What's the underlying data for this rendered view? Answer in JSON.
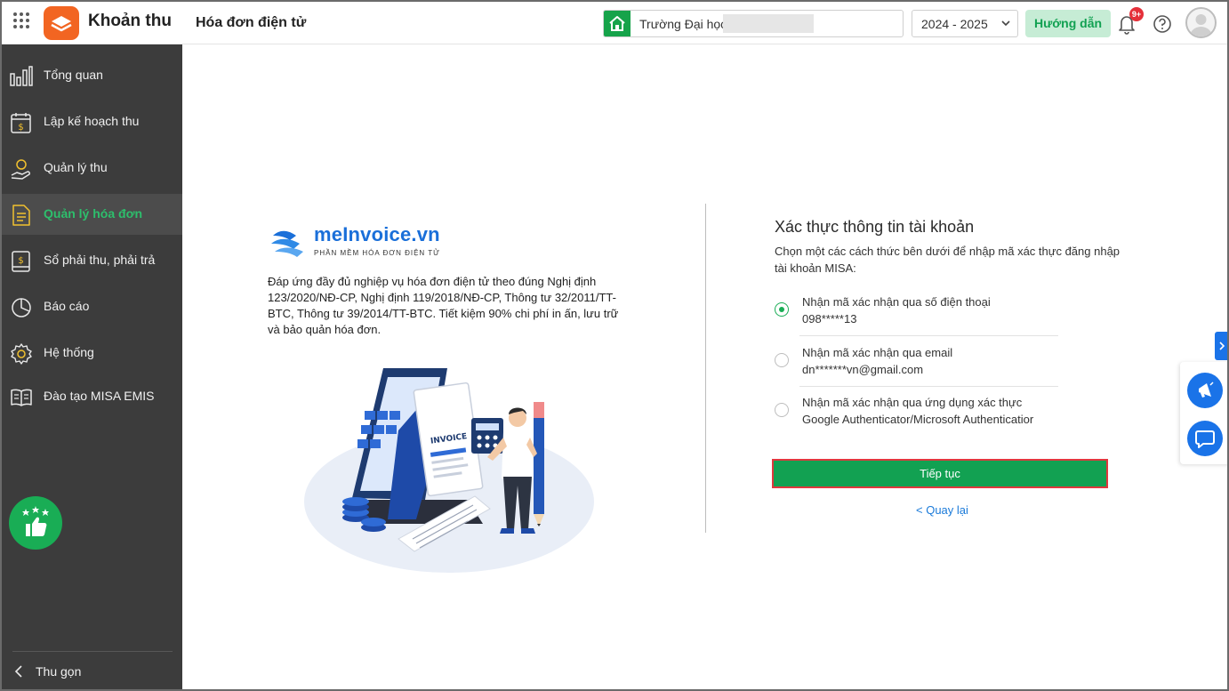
{
  "header": {
    "app_title": "Khoản thu",
    "page_title": "Hóa đơn điện tử",
    "school_label": "Trường Đại học",
    "school_year": "2024 - 2025",
    "help_label": "Hướng dẫn",
    "notification_badge": "9+"
  },
  "sidebar": {
    "items": [
      {
        "label": "Tổng quan",
        "icon": "bar-chart-icon"
      },
      {
        "label": "Lập kế hoạch thu",
        "icon": "calendar-dollar-icon"
      },
      {
        "label": "Quản lý thu",
        "icon": "hand-coin-icon"
      },
      {
        "label": "Quản lý hóa đơn",
        "icon": "document-icon",
        "active": true
      },
      {
        "label": "Sổ phải thu, phải trả",
        "icon": "ledger-icon"
      },
      {
        "label": "Báo cáo",
        "icon": "pie-chart-icon"
      },
      {
        "label": "Hệ thống",
        "icon": "gear-icon"
      },
      {
        "label": "Đào tạo MISA EMIS",
        "icon": "open-book-icon"
      }
    ],
    "collapse_label": "Thu gọn"
  },
  "promo": {
    "brand_name": "meInvoice.vn",
    "brand_tagline": "PHẦN MỀM HÓA ĐƠN ĐIỆN TỬ",
    "description": "Đáp ứng đầy đủ nghiệp vụ hóa đơn điện tử theo đúng Nghị định 123/2020/NĐ-CP, Nghị định 119/2018/NĐ-CP, Thông tư 32/2011/TT-BTC, Thông tư 39/2014/TT-BTC. Tiết kiệm 90% chi phí in ấn, lưu trữ và bảo quản hóa đơn.",
    "illustration_text": "INVOICE"
  },
  "auth": {
    "title": "Xác thực thông tin tài khoản",
    "subtitle": "Chọn một các cách thức bên dưới để nhập mã xác thực đăng nhập tài khoản MISA:",
    "options": [
      {
        "label": "Nhận mã xác nhận qua số điện thoại",
        "value": "098*****13",
        "selected": true
      },
      {
        "label": "Nhận mã xác nhận qua email",
        "value": "dn*******vn@gmail.com",
        "selected": false
      },
      {
        "label": "Nhận mã xác nhận qua ứng dụng xác thực",
        "value": "Google Authenticator/Microsoft Authenticatior",
        "selected": false
      }
    ],
    "continue_label": "Tiếp tục",
    "back_label": "< Quay lại"
  },
  "colors": {
    "brand_orange": "#f26522",
    "primary_green": "#12a152",
    "sidebar_bg": "#3c3c3c",
    "active_green": "#2dbf6c",
    "link_blue": "#1a7ad9",
    "highlight_red": "#e0383e"
  }
}
